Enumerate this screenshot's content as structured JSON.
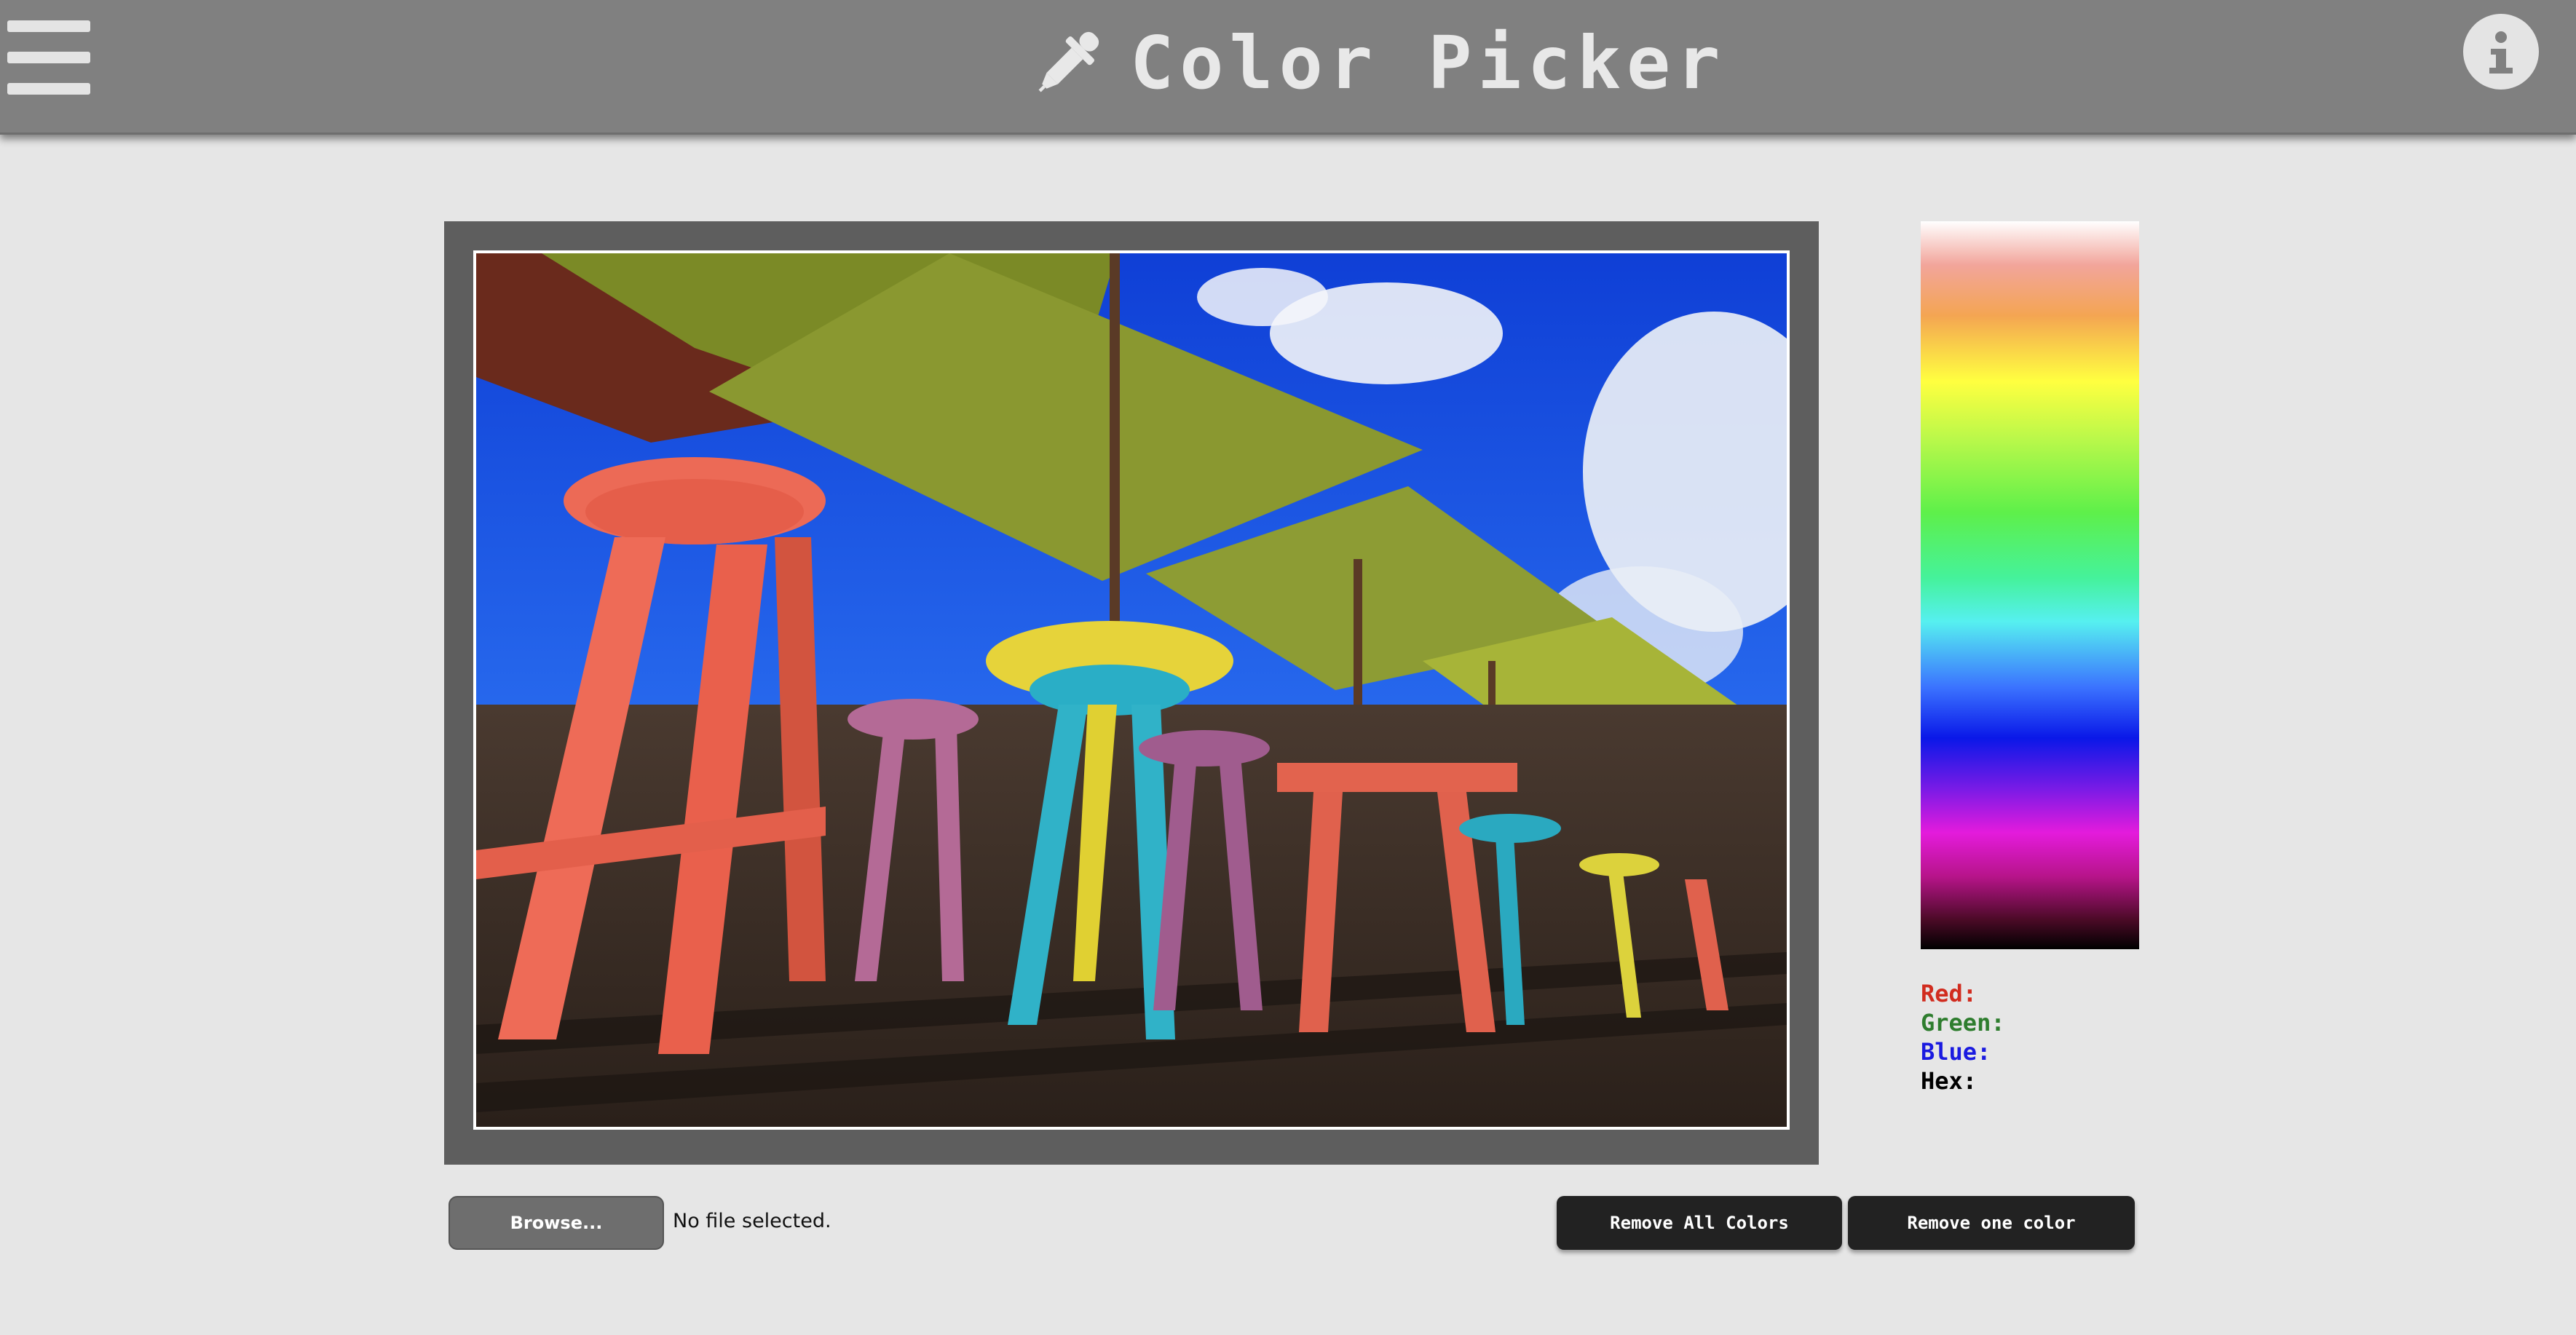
{
  "header": {
    "title": "Color Picker",
    "menu_icon": "hamburger-menu-icon",
    "logo_icon": "eyedropper-icon",
    "info_icon": "info-icon",
    "background": "#808080"
  },
  "picker": {
    "red_label": "Red:",
    "green_label": "Green:",
    "blue_label": "Blue:",
    "hex_label": "Hex:",
    "label_colors": {
      "red": "#d12c1f",
      "green": "#2e7d2e",
      "blue": "#1a1ae0",
      "hex": "#000000"
    }
  },
  "file": {
    "browse_label": "Browse...",
    "status": "No file selected."
  },
  "actions": {
    "remove_all_label": "Remove All Colors",
    "remove_one_label": "Remove one color"
  }
}
